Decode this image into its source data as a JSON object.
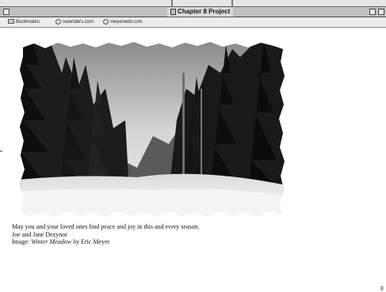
{
  "window": {
    "title": "Chapter 8 Project"
  },
  "toolbar": {
    "bookmarks": [
      {
        "label": "Bookmarks",
        "icon": "folder-icon"
      },
      {
        "label": "newriders.com",
        "icon": "globe-icon"
      },
      {
        "label": "meyerweb.com",
        "icon": "globe-icon"
      }
    ]
  },
  "page": {
    "message": "May you and your loved ones find peace and joy in this and every season.",
    "signature": "Joe and Jane Dezynor",
    "credit": {
      "prefix": "Image: ",
      "title": "Winter Meadow",
      "suffix": " by Eric Meyer"
    },
    "corner_mark": "E"
  },
  "colors": {
    "chrome": "#d9d9d9",
    "page_background": "#ffffff",
    "text": "#111111"
  }
}
